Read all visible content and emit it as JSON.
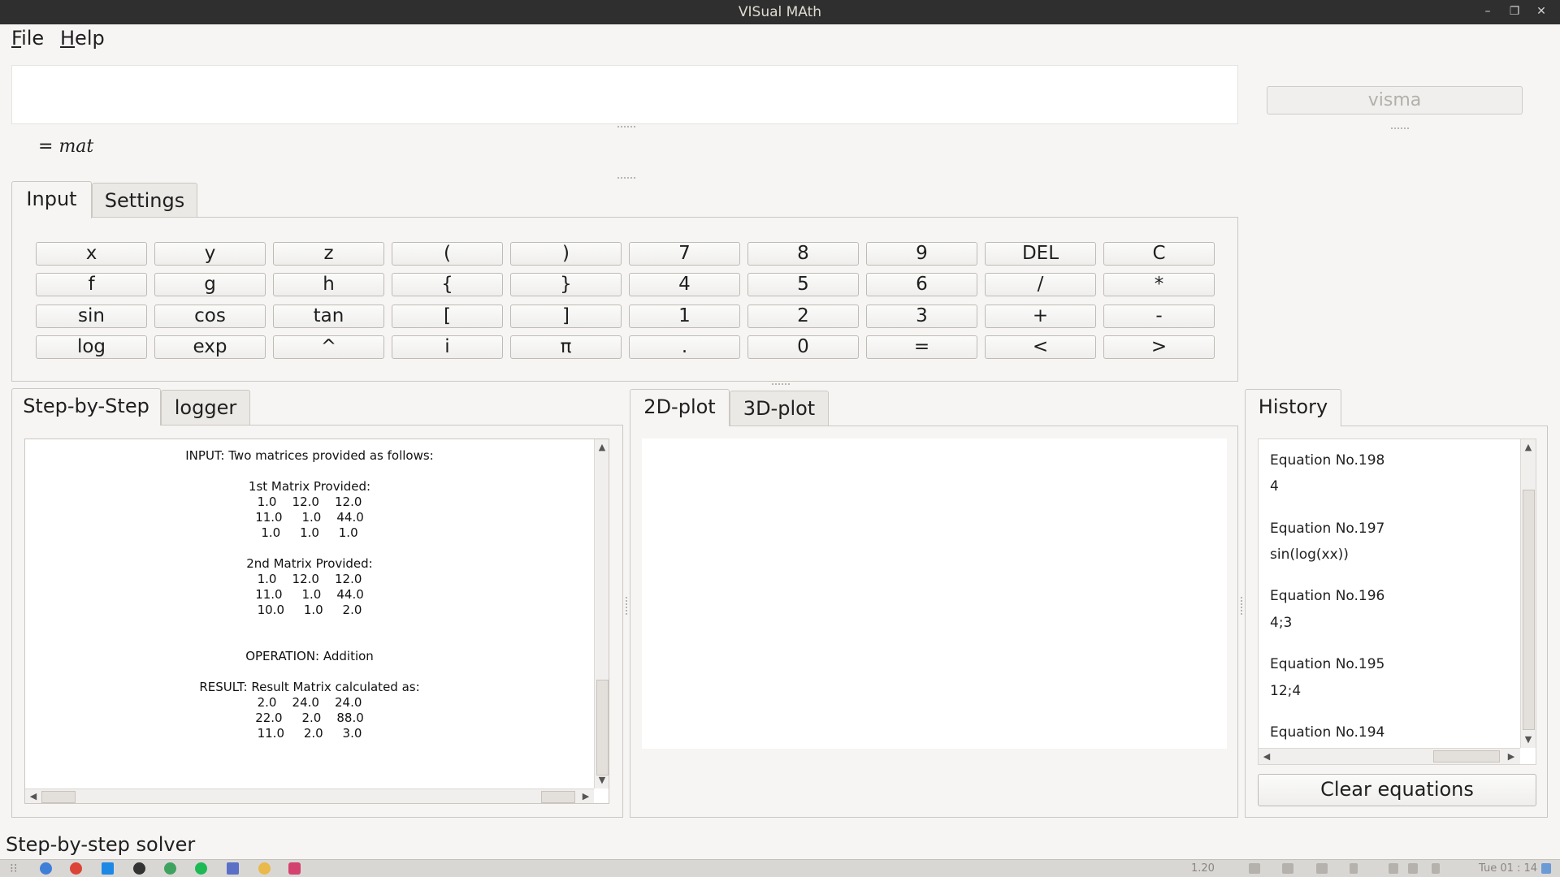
{
  "window": {
    "title": "VISual MAth",
    "controls": [
      "–",
      "❐",
      "✕"
    ]
  },
  "menubar": {
    "items": [
      {
        "first": "F",
        "rest": "ile"
      },
      {
        "first": "H",
        "rest": "elp"
      }
    ]
  },
  "input": {
    "formula_value": "",
    "visma_button": "visma",
    "result_prefix": "= ",
    "result_value": "mat"
  },
  "top_tabs": [
    "Input",
    "Settings"
  ],
  "keypad": [
    [
      "x",
      "y",
      "z",
      "(",
      ")",
      "7",
      "8",
      "9",
      "DEL",
      "C"
    ],
    [
      "f",
      "g",
      "h",
      "{",
      "}",
      "4",
      "5",
      "6",
      "/",
      "*"
    ],
    [
      "sin",
      "cos",
      "tan",
      "[",
      "]",
      "1",
      "2",
      "3",
      "+",
      "-"
    ],
    [
      "log",
      "exp",
      "^",
      "i",
      "π",
      ".",
      "0",
      "=",
      "<",
      ">"
    ]
  ],
  "left_tabs": [
    "Step-by-Step",
    "logger"
  ],
  "steps": {
    "input_line": "INPUT: Two matrices provided as follows:",
    "m1_title": "1st Matrix Provided:",
    "m1_rows": [
      "1.0    12.0    12.0",
      "11.0     1.0    44.0",
      "1.0     1.0     1.0"
    ],
    "m2_title": "2nd Matrix Provided:",
    "m2_rows": [
      "1.0    12.0    12.0",
      "11.0     1.0    44.0",
      "10.0     1.0     2.0"
    ],
    "operation": "OPERATION: Addition",
    "result_title": "RESULT: Result Matrix calculated as:",
    "result_rows": [
      "2.0    24.0    24.0",
      "22.0     2.0    88.0",
      "11.0     2.0     3.0"
    ]
  },
  "plot_tabs": [
    "2D-plot",
    "3D-plot"
  ],
  "history": {
    "tab": "History",
    "items": [
      {
        "label": "Equation No.198",
        "value": "4"
      },
      {
        "label": "Equation No.197",
        "value": "sin(log(xx))"
      },
      {
        "label": "Equation No.196",
        "value": "4;3"
      },
      {
        "label": "Equation No.195",
        "value": "12;4"
      },
      {
        "label": "Equation No.194",
        "value": ""
      }
    ],
    "clear_button": "Clear equations"
  },
  "status": {
    "text": "Step-by-step solver"
  },
  "taskbar": {
    "clock": "Tue 01 : 14",
    "network_speed": "1.20",
    "colors": {
      "chrome": "#db4437",
      "vscode": "#1e88e5",
      "spotify": "#1db954",
      "steam": "#333333",
      "zeal": "#3fa35f",
      "visma": "#d4426f"
    }
  }
}
